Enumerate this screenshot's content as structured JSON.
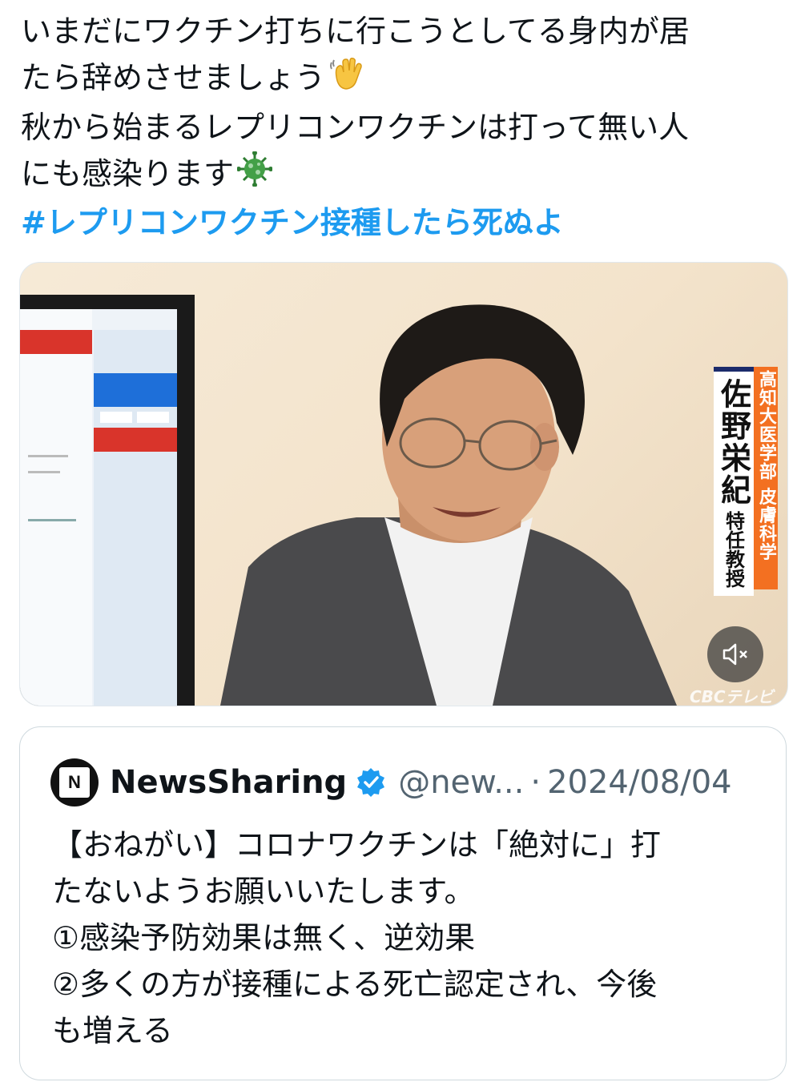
{
  "tweet": {
    "lines": [
      "いまだにワクチン打ちに行こうとしてる身内が居",
      "たら辞めさせましょう",
      "秋から始まるレプリコンワクチンは打って無い人",
      "にも感染ります"
    ],
    "emoji_line2": "waving-hand-emoji",
    "emoji_line4": "microbe-emoji",
    "hashtag": "#レプリコンワクチン接種したら死ぬよ"
  },
  "media": {
    "caption_name": "佐野栄紀",
    "caption_role": "特任教授",
    "caption_affiliation": "高知大医学部 皮膚科学",
    "watermark": "CBCテレビ",
    "mute_icon": "speaker-muted-icon"
  },
  "quote": {
    "avatar_letter": "N",
    "author_name": "NewsSharing",
    "verified_icon": "verified-badge-icon",
    "handle": "@new...",
    "separator": "·",
    "date": "2024/08/04",
    "body_lines": [
      "【おねがい】コロナワクチンは「絶対に」打",
      "たないようお願いいたします。",
      "①感染予防効果は無く、逆効果",
      "②多くの方が接種による死亡認定され、今後",
      "も増える"
    ]
  },
  "colors": {
    "link": "#1d9bf0",
    "caption_orange": "#f37021",
    "caption_navy": "#1b2b6b",
    "muted_text": "#536471"
  }
}
